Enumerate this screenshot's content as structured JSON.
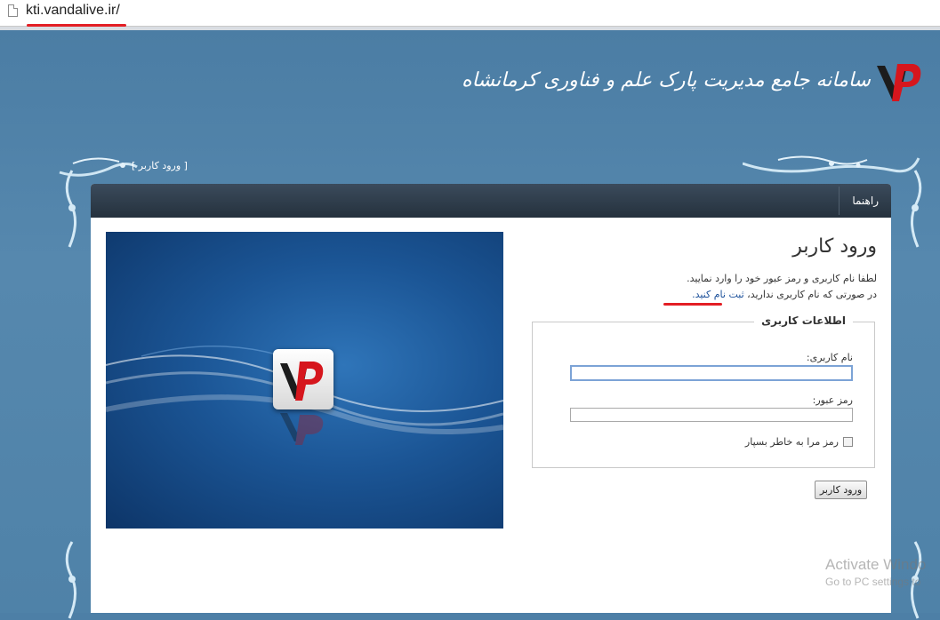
{
  "browser": {
    "url": "kti.vandalive.ir/",
    "accent": "#e31e24"
  },
  "header": {
    "site_title": "سامانه جامع مدیریت پارک علم و فناوری کرمانشاه",
    "logo_icon": "vp-logo-icon"
  },
  "breadcrumb": {
    "text": "[ ورود کاربر ]"
  },
  "navbar": {
    "help_label": "راهنما"
  },
  "login": {
    "title": "ورود کاربر",
    "intro_line1": "لطفا نام کاربری و رمز عبور خود را وارد نمایید.",
    "intro_line2_prefix": "در صورتی که نام کاربری ندارید،",
    "register_link": "ثبت نام کنید.",
    "fieldset_legend": "اطلاعات کاربری",
    "username_label": "نام کاربری:",
    "username_value": "",
    "password_label": "رمز عبور:",
    "password_value": "",
    "remember_label": "رمز مرا به خاطر بسپار",
    "remember_checked": false,
    "submit_label": "ورود کاربر"
  },
  "watermark": {
    "line1": "Activate Windo",
    "line2": "Go to PC settings to"
  },
  "colors": {
    "page_bg": "#4d7fa6",
    "nav_bar": "#2d3a47",
    "link": "#1a4f9a"
  }
}
